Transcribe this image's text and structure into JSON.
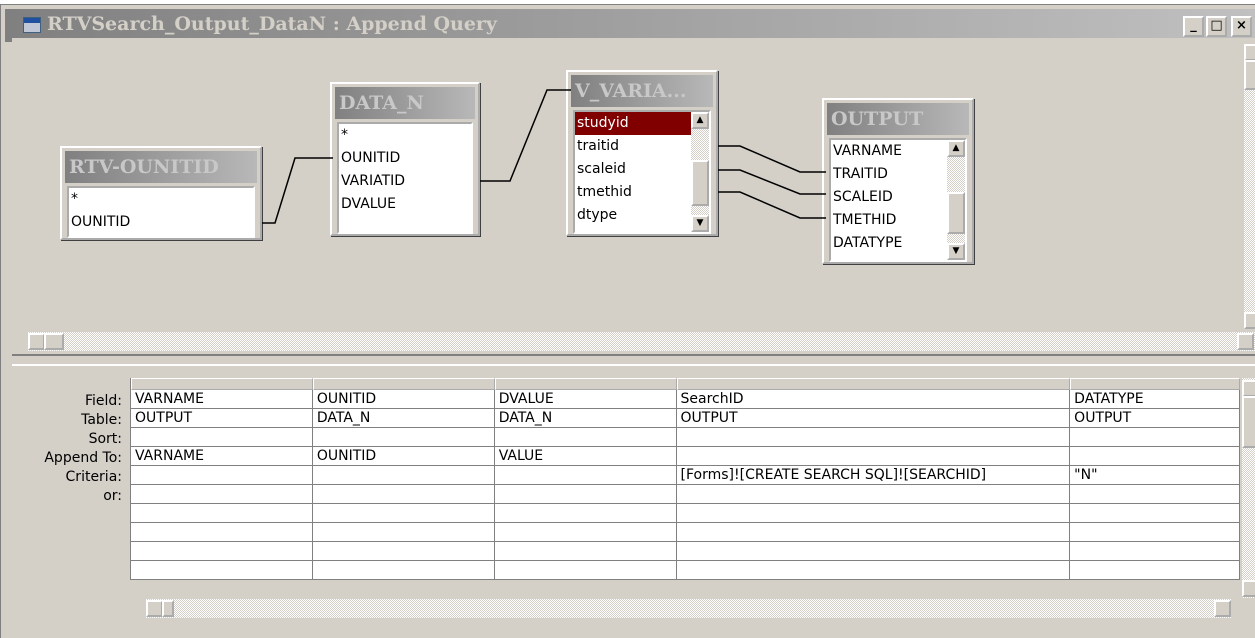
{
  "window": {
    "title": "RTVSearch_Output_DataN : Append Query",
    "minimize": "_",
    "maximize": "□",
    "close": "×"
  },
  "tables": [
    {
      "name": "RTV-OUNITID",
      "fields": [
        "*",
        "OUNITID"
      ]
    },
    {
      "name": "DATA_N",
      "fields": [
        "*",
        "OUNITID",
        "VARIATID",
        "DVALUE"
      ]
    },
    {
      "name": "V_VARIA...",
      "fields": [
        "studyid",
        "traitid",
        "scaleid",
        "tmethid",
        "dtype"
      ],
      "selected": "studyid"
    },
    {
      "name": "OUTPUT",
      "fields": [
        "VARNAME",
        "TRAITID",
        "SCALEID",
        "TMETHID",
        "DATATYPE"
      ]
    }
  ],
  "grid": {
    "row_labels": [
      "Field:",
      "Table:",
      "Sort:",
      "Append To:",
      "Criteria:",
      "or:"
    ],
    "columns": [
      {
        "field": "VARNAME",
        "table": "OUTPUT",
        "sort": "",
        "append_to": "VARNAME",
        "criteria": "",
        "or": ""
      },
      {
        "field": "OUNITID",
        "table": "DATA_N",
        "sort": "",
        "append_to": "OUNITID",
        "criteria": "",
        "or": ""
      },
      {
        "field": "DVALUE",
        "table": "DATA_N",
        "sort": "",
        "append_to": "VALUE",
        "criteria": "",
        "or": ""
      },
      {
        "field": "SearchID",
        "table": "OUTPUT",
        "sort": "",
        "append_to": "",
        "criteria": "[Forms]![CREATE SEARCH SQL]![SEARCHID]",
        "or": ""
      },
      {
        "field": "DATATYPE",
        "table": "OUTPUT",
        "sort": "",
        "append_to": "",
        "criteria": "\"N\"",
        "or": ""
      }
    ]
  },
  "icons": {
    "window_icon": "query-icon",
    "scroll_up": "arrow-up-icon",
    "scroll_down": "arrow-down-icon",
    "scroll_left": "arrow-left-icon",
    "scroll_right": "arrow-right-icon"
  },
  "colors": {
    "selected_field_bg": "#800000",
    "title_gradient_start": "#808080",
    "face": "#d4d0c8"
  }
}
